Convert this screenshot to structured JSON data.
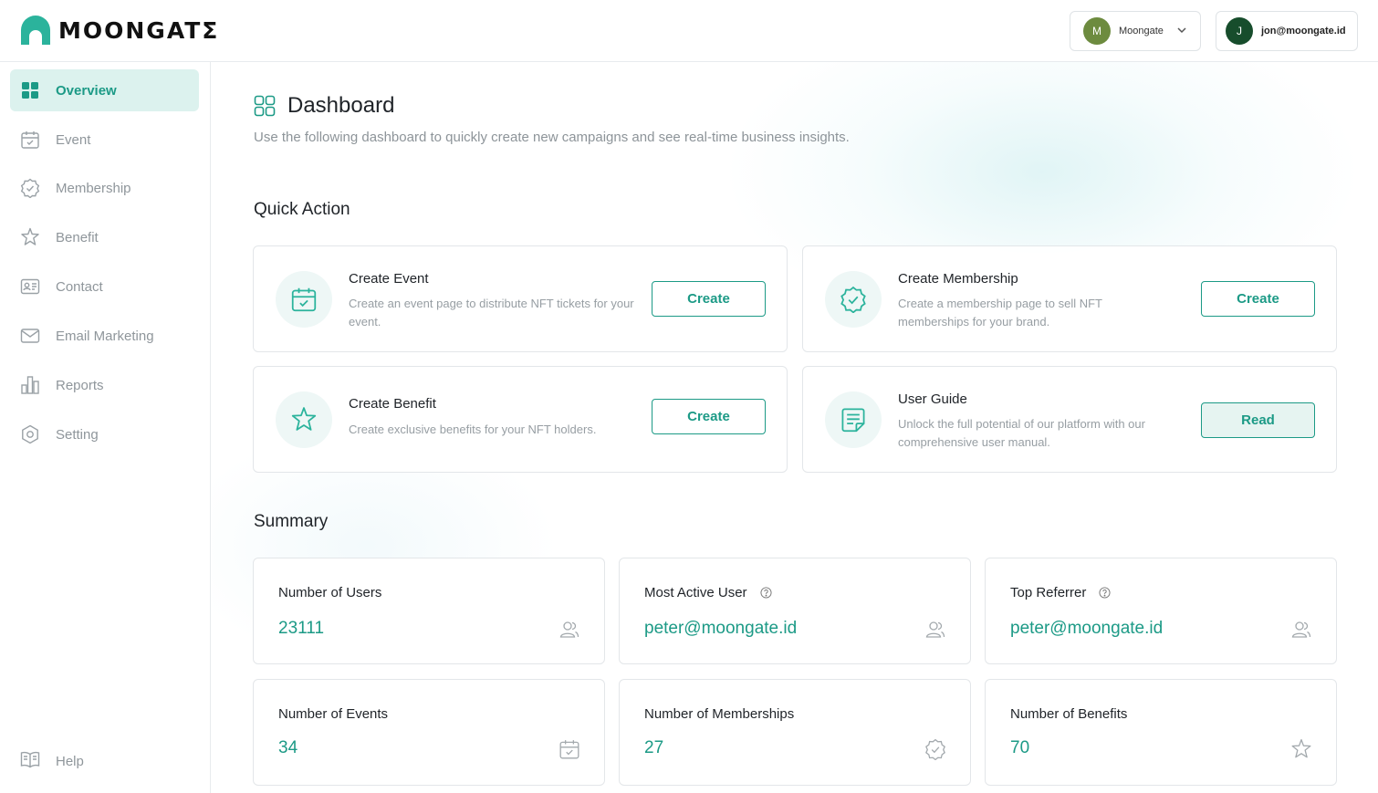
{
  "brand": {
    "name": "MOONGATΣ",
    "accent": "#1c9a86"
  },
  "header": {
    "org": {
      "initial": "M",
      "name": "Moongate"
    },
    "account": {
      "initial": "J",
      "email": "jon@moongate.id"
    }
  },
  "sidebar": {
    "items": [
      {
        "label": "Overview",
        "icon": "grid-icon",
        "active": true
      },
      {
        "label": "Event",
        "icon": "calendar-icon"
      },
      {
        "label": "Membership",
        "icon": "badge-check-icon"
      },
      {
        "label": "Benefit",
        "icon": "star-icon"
      },
      {
        "label": "Contact",
        "icon": "contact-card-icon"
      },
      {
        "label": "Email Marketing",
        "icon": "mail-icon"
      },
      {
        "label": "Reports",
        "icon": "bar-chart-icon"
      },
      {
        "label": "Setting",
        "icon": "settings-icon"
      }
    ],
    "help": {
      "label": "Help",
      "icon": "book-icon"
    }
  },
  "page": {
    "title": "Dashboard",
    "subtitle": "Use the following dashboard to quickly create new campaigns and see real-time business insights."
  },
  "quick_action": {
    "title": "Quick Action",
    "cards": [
      {
        "title": "Create Event",
        "description": "Create an event page to distribute NFT tickets for your event.",
        "button": "Create",
        "icon": "calendar-icon"
      },
      {
        "title": "Create Membership",
        "description": "Create a membership page to sell NFT memberships for your brand.",
        "button": "Create",
        "icon": "badge-check-icon"
      },
      {
        "title": "Create Benefit",
        "description": "Create exclusive benefits for your NFT holders.",
        "button": "Create",
        "icon": "star-icon"
      },
      {
        "title": "User Guide",
        "description": "Unlock the full potential of our platform with our comprehensive user manual.",
        "button": "Read",
        "icon": "document-icon"
      }
    ]
  },
  "summary": {
    "title": "Summary",
    "cards": [
      {
        "label": "Number of Users",
        "value": "23111",
        "icon": "users-icon"
      },
      {
        "label": "Most Active User",
        "value": "peter@moongate.id",
        "icon": "users-icon",
        "help": true
      },
      {
        "label": "Top Referrer",
        "value": "peter@moongate.id",
        "icon": "users-icon",
        "help": true
      },
      {
        "label": "Number of Events",
        "value": "34",
        "icon": "calendar-icon"
      },
      {
        "label": "Number of Memberships",
        "value": "27",
        "icon": "badge-check-icon"
      },
      {
        "label": "Number of Benefits",
        "value": "70",
        "icon": "star-icon"
      }
    ]
  }
}
